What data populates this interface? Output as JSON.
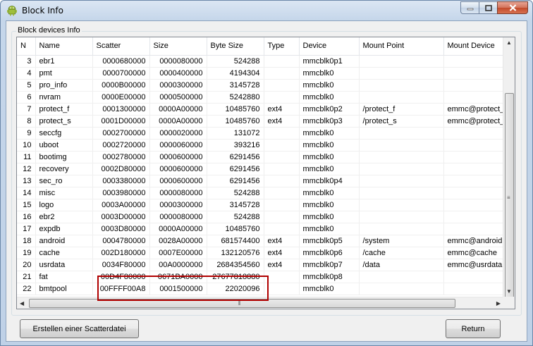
{
  "window": {
    "title": "Block Info",
    "icon": "android-icon"
  },
  "group": {
    "label": "Block devices Info"
  },
  "columns": {
    "n": "N",
    "name": "Name",
    "scatter": "Scatter",
    "size": "Size",
    "byte_size": "Byte Size",
    "type": "Type",
    "device": "Device",
    "mount_point": "Mount Point",
    "mount_device": "Mount Device"
  },
  "rows": [
    {
      "n": "3",
      "name": "ebr1",
      "scatter": "0000680000",
      "size": "0000080000",
      "byte_size": "524288",
      "type": "",
      "device": "mmcblk0p1",
      "mount_point": "",
      "mount_device": ""
    },
    {
      "n": "4",
      "name": "pmt",
      "scatter": "0000700000",
      "size": "0000400000",
      "byte_size": "4194304",
      "type": "",
      "device": "mmcblk0",
      "mount_point": "",
      "mount_device": ""
    },
    {
      "n": "5",
      "name": "pro_info",
      "scatter": "0000B00000",
      "size": "0000300000",
      "byte_size": "3145728",
      "type": "",
      "device": "mmcblk0",
      "mount_point": "",
      "mount_device": ""
    },
    {
      "n": "6",
      "name": "nvram",
      "scatter": "0000E00000",
      "size": "0000500000",
      "byte_size": "5242880",
      "type": "",
      "device": "mmcblk0",
      "mount_point": "",
      "mount_device": ""
    },
    {
      "n": "7",
      "name": "protect_f",
      "scatter": "0001300000",
      "size": "0000A00000",
      "byte_size": "10485760",
      "type": "ext4",
      "device": "mmcblk0p2",
      "mount_point": "/protect_f",
      "mount_device": "emmc@protect_f"
    },
    {
      "n": "8",
      "name": "protect_s",
      "scatter": "0001D00000",
      "size": "0000A00000",
      "byte_size": "10485760",
      "type": "ext4",
      "device": "mmcblk0p3",
      "mount_point": "/protect_s",
      "mount_device": "emmc@protect_s"
    },
    {
      "n": "9",
      "name": "seccfg",
      "scatter": "0002700000",
      "size": "0000020000",
      "byte_size": "131072",
      "type": "",
      "device": "mmcblk0",
      "mount_point": "",
      "mount_device": ""
    },
    {
      "n": "10",
      "name": "uboot",
      "scatter": "0002720000",
      "size": "0000060000",
      "byte_size": "393216",
      "type": "",
      "device": "mmcblk0",
      "mount_point": "",
      "mount_device": ""
    },
    {
      "n": "11",
      "name": "bootimg",
      "scatter": "0002780000",
      "size": "0000600000",
      "byte_size": "6291456",
      "type": "",
      "device": "mmcblk0",
      "mount_point": "",
      "mount_device": ""
    },
    {
      "n": "12",
      "name": "recovery",
      "scatter": "0002D80000",
      "size": "0000600000",
      "byte_size": "6291456",
      "type": "",
      "device": "mmcblk0",
      "mount_point": "",
      "mount_device": ""
    },
    {
      "n": "13",
      "name": "sec_ro",
      "scatter": "0003380000",
      "size": "0000600000",
      "byte_size": "6291456",
      "type": "",
      "device": "mmcblk0p4",
      "mount_point": "",
      "mount_device": ""
    },
    {
      "n": "14",
      "name": "misc",
      "scatter": "0003980000",
      "size": "0000080000",
      "byte_size": "524288",
      "type": "",
      "device": "mmcblk0",
      "mount_point": "",
      "mount_device": ""
    },
    {
      "n": "15",
      "name": "logo",
      "scatter": "0003A00000",
      "size": "0000300000",
      "byte_size": "3145728",
      "type": "",
      "device": "mmcblk0",
      "mount_point": "",
      "mount_device": ""
    },
    {
      "n": "16",
      "name": "ebr2",
      "scatter": "0003D00000",
      "size": "0000080000",
      "byte_size": "524288",
      "type": "",
      "device": "mmcblk0",
      "mount_point": "",
      "mount_device": ""
    },
    {
      "n": "17",
      "name": "expdb",
      "scatter": "0003D80000",
      "size": "0000A00000",
      "byte_size": "10485760",
      "type": "",
      "device": "mmcblk0",
      "mount_point": "",
      "mount_device": ""
    },
    {
      "n": "18",
      "name": "android",
      "scatter": "0004780000",
      "size": "0028A00000",
      "byte_size": "681574400",
      "type": "ext4",
      "device": "mmcblk0p5",
      "mount_point": "/system",
      "mount_device": "emmc@android"
    },
    {
      "n": "19",
      "name": "cache",
      "scatter": "002D180000",
      "size": "0007E00000",
      "byte_size": "132120576",
      "type": "ext4",
      "device": "mmcblk0p6",
      "mount_point": "/cache",
      "mount_device": "emmc@cache"
    },
    {
      "n": "20",
      "name": "usrdata",
      "scatter": "0034F80000",
      "size": "00A0000000",
      "byte_size": "2684354560",
      "type": "ext4",
      "device": "mmcblk0p7",
      "mount_point": "/data",
      "mount_device": "emmc@usrdata"
    },
    {
      "n": "21",
      "name": "fat",
      "scatter": "00D4F80000",
      "size": "0671BA0000",
      "byte_size": "27677818880",
      "type": "",
      "device": "mmcblk0p8",
      "mount_point": "",
      "mount_device": ""
    },
    {
      "n": "22",
      "name": "bmtpool",
      "scatter": "00FFFF00A8",
      "size": "0001500000",
      "byte_size": "22020096",
      "type": "",
      "device": "mmcblk0",
      "mount_point": "",
      "mount_device": ""
    }
  ],
  "buttons": {
    "create_scatter": "Erstellen einer Scatterdatei",
    "return": "Return"
  },
  "colors": {
    "highlight": "#b00000"
  }
}
